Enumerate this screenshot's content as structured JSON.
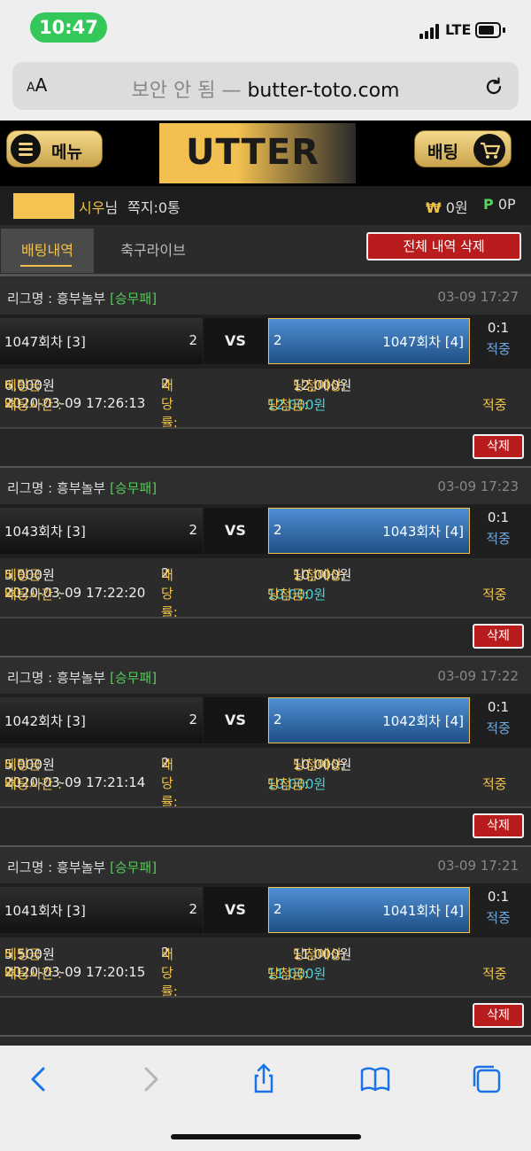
{
  "status": {
    "time": "10:47",
    "network": "LTE"
  },
  "browser": {
    "aa_small": "A",
    "aa_big": "A",
    "insecure_label": "보안 안 됨",
    "dash": " — ",
    "domain": "butter-toto.com"
  },
  "header": {
    "menu_label": "메뉴",
    "logo_text": "UTTER",
    "bet_label": "배팅"
  },
  "user": {
    "name": "시우",
    "suffix": "님",
    "messages": "쪽지:0통",
    "won_symbol": "₩",
    "won": "0원",
    "point_symbol": "P",
    "points": "0P"
  },
  "tabs": {
    "history": "배팅내역",
    "live": "축구라이브",
    "delete_all": "전체 내역 삭제"
  },
  "labels": {
    "league_prefix": "리그명 : ",
    "vs": "VS",
    "bet_amount": "베팅금액: ",
    "odds": "배당률: ",
    "expected": "당첨예상: ",
    "bet_time": "배팅시간 : ",
    "win_amount": "당첨금: ",
    "delete": "삭제"
  },
  "bets": [
    {
      "league": "흥부놀부",
      "tag": "[승무패]",
      "date": "03-09 17:27",
      "home": "1047회차 [3]",
      "home_odds": "2",
      "away_odds": "2",
      "away": "1047회차 [4]",
      "score": "0:1",
      "hit": "적중",
      "amount": "6,000원",
      "odds": "2",
      "expected": "12,000원",
      "time": "2020-03-09 17:26:13",
      "win": "12,000원",
      "result": "적중"
    },
    {
      "league": "흥부놀부",
      "tag": "[승무패]",
      "date": "03-09 17:23",
      "home": "1043회차 [3]",
      "home_odds": "2",
      "away_odds": "2",
      "away": "1043회차 [4]",
      "score": "0:1",
      "hit": "적중",
      "amount": "5,000원",
      "odds": "2",
      "expected": "10,000원",
      "time": "2020-03-09 17:22:20",
      "win": "10,000원",
      "result": "적중"
    },
    {
      "league": "흥부놀부",
      "tag": "[승무패]",
      "date": "03-09 17:22",
      "home": "1042회차 [3]",
      "home_odds": "2",
      "away_odds": "2",
      "away": "1042회차 [4]",
      "score": "0:1",
      "hit": "적중",
      "amount": "5,000원",
      "odds": "2",
      "expected": "10,000원",
      "time": "2020-03-09 17:21:14",
      "win": "10,000원",
      "result": "적중"
    },
    {
      "league": "흥부놀부",
      "tag": "[승무패]",
      "date": "03-09 17:21",
      "home": "1041회차 [3]",
      "home_odds": "2",
      "away_odds": "2",
      "away": "1041회차 [4]",
      "score": "0:1",
      "hit": "적중",
      "amount": "5,500원",
      "odds": "2",
      "expected": "11,000원",
      "time": "2020-03-09 17:20:15",
      "win": "11,000원",
      "result": "적중"
    }
  ],
  "colors": {
    "gold": "#f1c24a",
    "green": "#57c95a",
    "blue": "#4f8fd3",
    "red": "#b91c1c",
    "cyan": "#4fd1d9"
  },
  "icons": [
    "hamburger-icon",
    "cart-icon",
    "reload-icon",
    "back-icon",
    "forward-icon",
    "share-icon",
    "bookmarks-icon",
    "tabs-icon"
  ]
}
